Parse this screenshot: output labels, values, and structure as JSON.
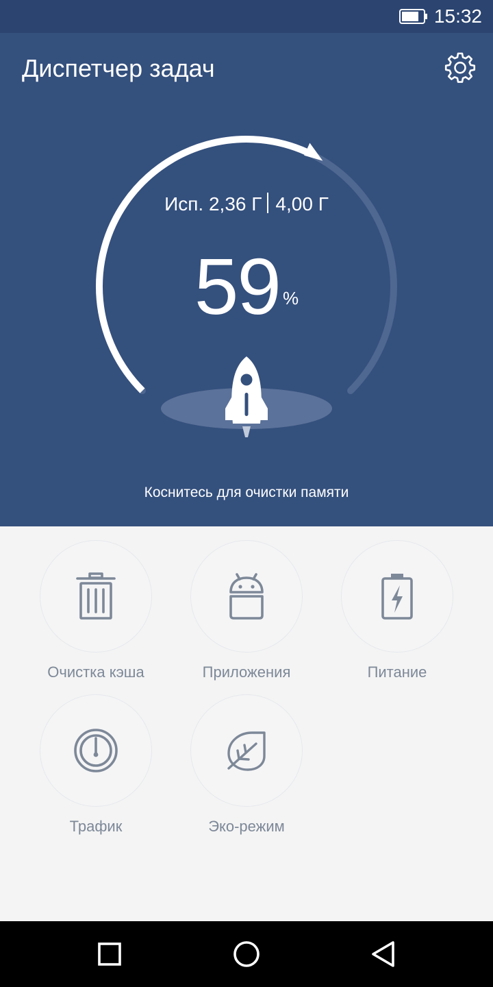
{
  "status_bar": {
    "time": "15:32",
    "battery_level": 0.8
  },
  "header": {
    "title": "Диспетчер задач"
  },
  "memory": {
    "used": "Исп. 2,36 Г",
    "total": "4,00 Г",
    "percent": "59",
    "percent_sign": "%",
    "usage_fraction": 0.59
  },
  "hint": "Коснитесь для очистки памяти",
  "tools": [
    {
      "label": "Очистка кэша",
      "icon": "trash-icon"
    },
    {
      "label": "Приложения",
      "icon": "android-icon"
    },
    {
      "label": "Питание",
      "icon": "battery-charging-icon"
    },
    {
      "label": "Трафик",
      "icon": "speedometer-icon"
    },
    {
      "label": "Эко-режим",
      "icon": "leaf-icon"
    }
  ],
  "navigation": {
    "buttons": [
      "recent-apps",
      "home",
      "back"
    ]
  },
  "colors": {
    "hero_bg": "#34507d",
    "status_bar_bg": "#2b4470",
    "panel_bg": "#f4f4f4",
    "icon_gray": "#7d8898",
    "nav_bg": "#000000"
  }
}
